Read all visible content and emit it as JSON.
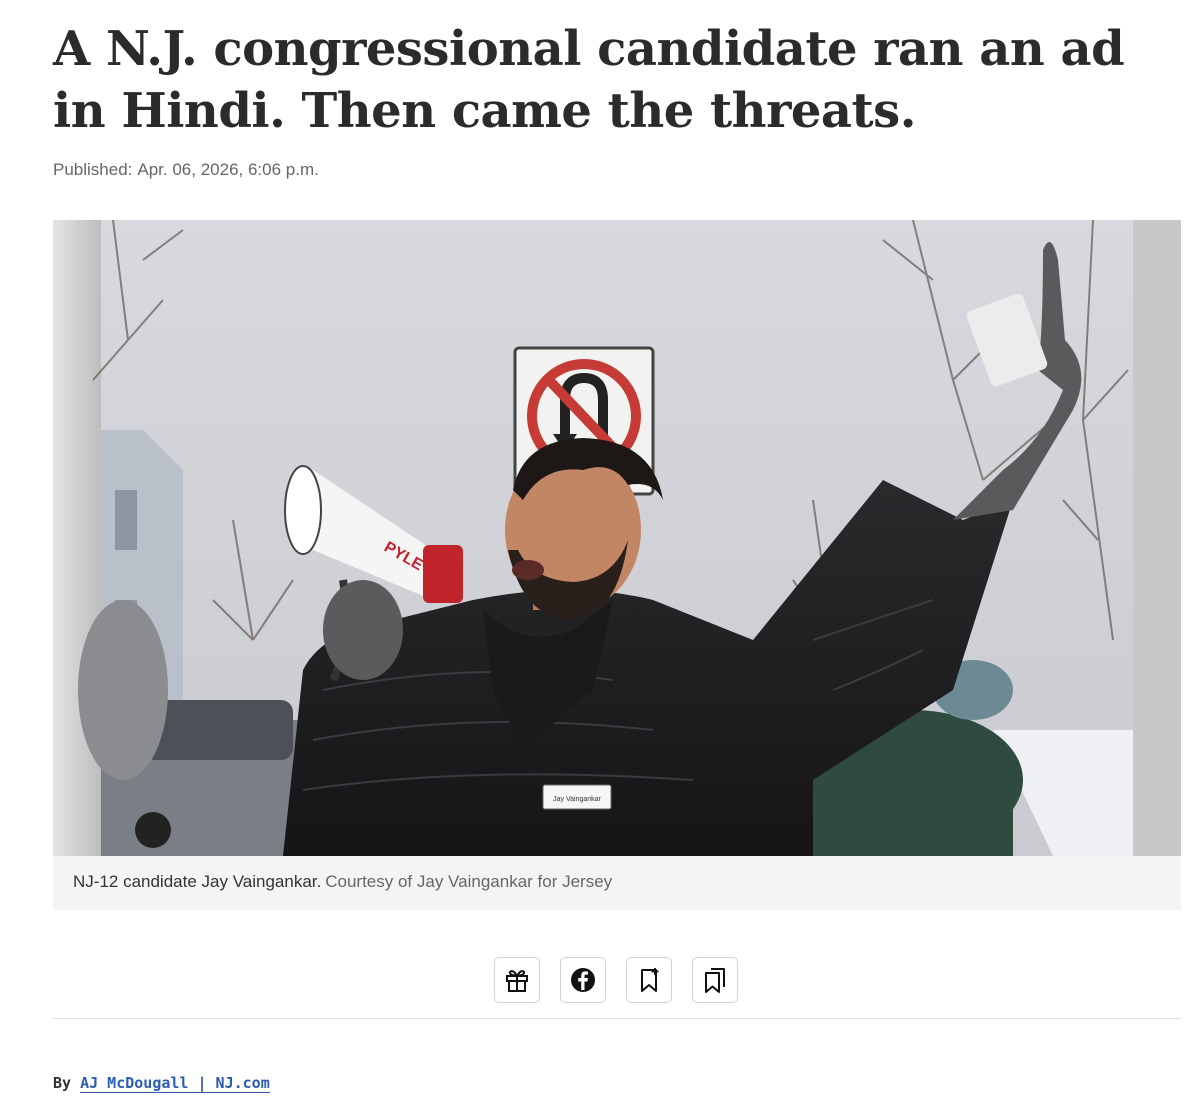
{
  "article": {
    "headline": "A N.J. congressional candidate ran an ad in Hindi. Then came the threats.",
    "published_label": "Published:",
    "published_date": "Apr. 06, 2026, 6:06 p.m."
  },
  "figure": {
    "caption": "NJ-12 candidate Jay Vaingankar.",
    "credit": "Courtesy of Jay Vaingankar for Jersey",
    "megaphone_brand": "PYLE",
    "name_tag_text": "Jay Vaingankar"
  },
  "share": {
    "buttons": [
      {
        "name": "gift",
        "icon": "gift-icon"
      },
      {
        "name": "facebook",
        "icon": "facebook-icon"
      },
      {
        "name": "save",
        "icon": "bookmark-add-icon"
      },
      {
        "name": "saved-list",
        "icon": "bookmarks-icon"
      }
    ]
  },
  "byline": {
    "prefix": "By",
    "author": "AJ McDougall | NJ.com"
  },
  "colors": {
    "link": "#2a5db0",
    "headline": "#2b2b2b",
    "caption_bg": "#f4f4f4"
  }
}
